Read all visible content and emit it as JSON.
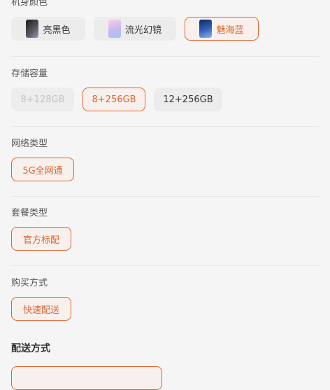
{
  "body_color": {
    "title": "机身颜色",
    "options": [
      {
        "label": "亮黑色",
        "selected": false,
        "icon": "phone-black-thumbnail"
      },
      {
        "label": "流光幻镜",
        "selected": false,
        "icon": "phone-gradient-thumbnail"
      },
      {
        "label": "魅海蓝",
        "selected": true,
        "icon": "phone-blue-thumbnail"
      }
    ]
  },
  "storage": {
    "title": "存储容量",
    "options": [
      {
        "label": "8+128GB",
        "selected": false,
        "disabled": true
      },
      {
        "label": "8+256GB",
        "selected": true,
        "disabled": false
      },
      {
        "label": "12+256GB",
        "selected": false,
        "disabled": false
      }
    ]
  },
  "network": {
    "title": "网络类型",
    "options": [
      {
        "label": "5G全网通",
        "selected": true
      }
    ]
  },
  "package": {
    "title": "套餐类型",
    "options": [
      {
        "label": "官方标配",
        "selected": true
      }
    ]
  },
  "purchase": {
    "title": "购买方式",
    "options": [
      {
        "label": "快速配送",
        "selected": true
      }
    ]
  },
  "delivery": {
    "title": "配送方式"
  },
  "colors": {
    "accent": "#e2632b",
    "background": "#f5f5f5",
    "chip": "#ececec"
  }
}
